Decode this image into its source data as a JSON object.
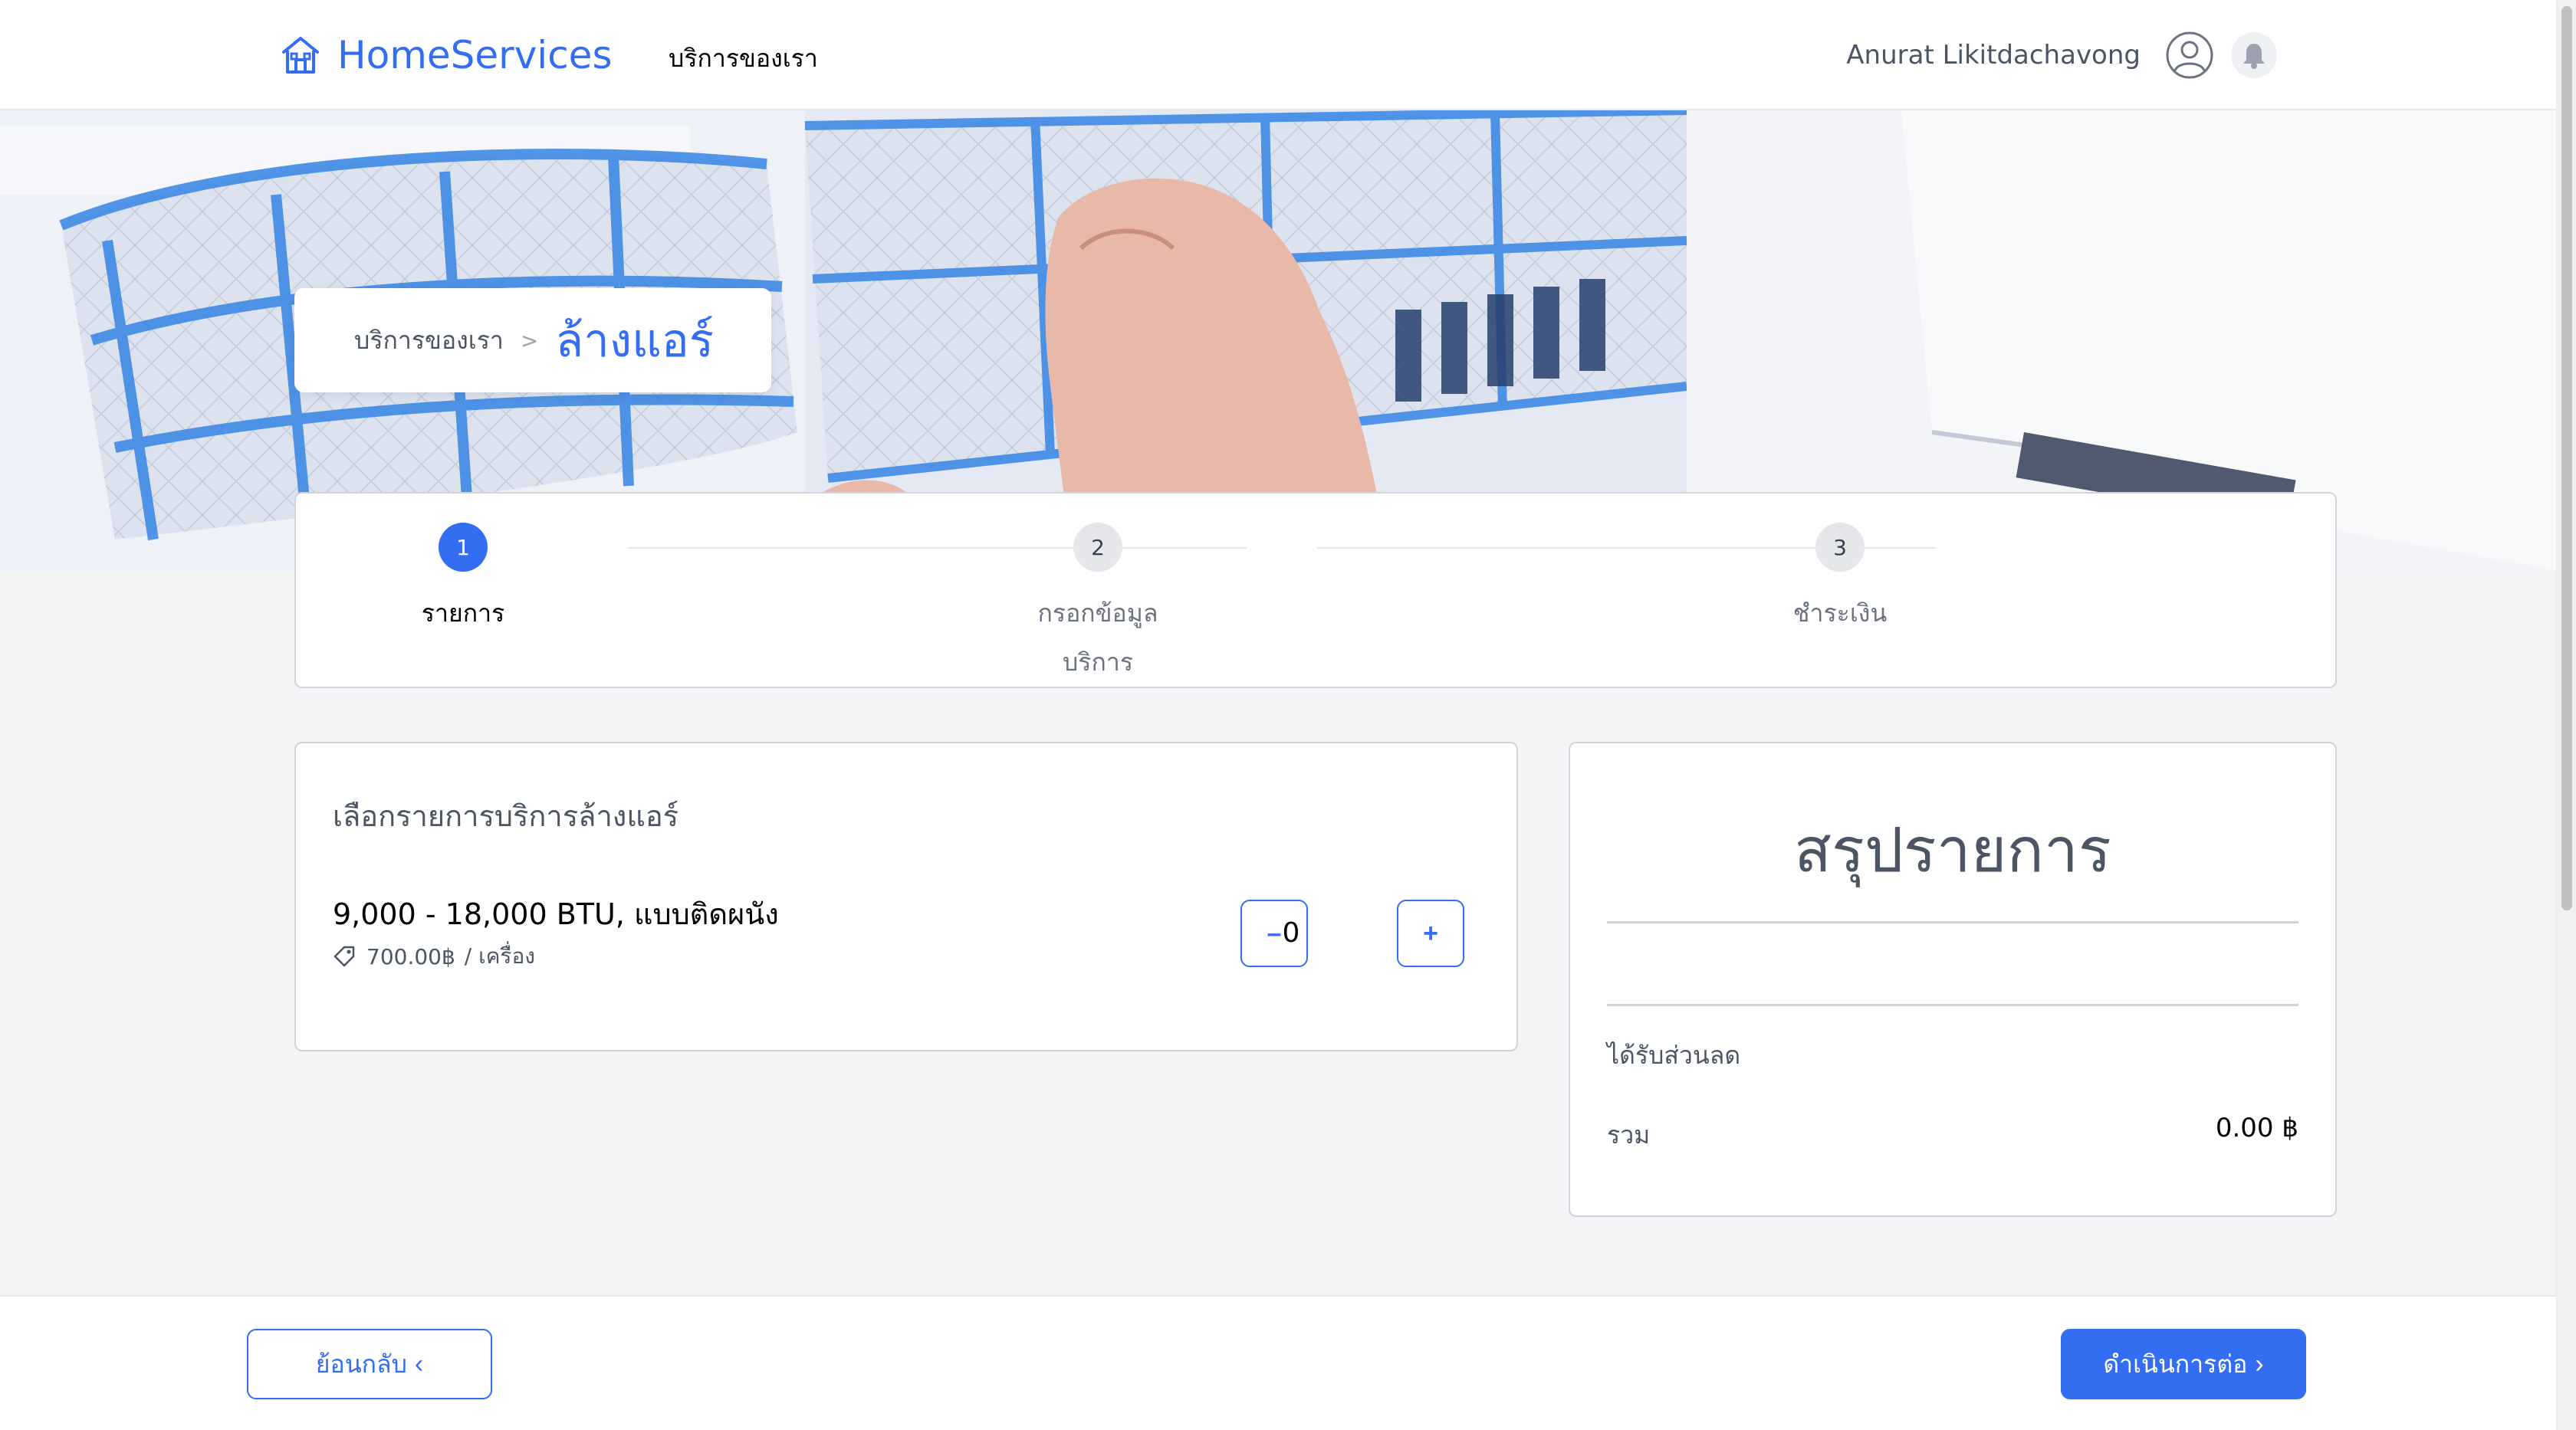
{
  "navbar": {
    "brand": "HomeServices",
    "nav_link": "บริการของเรา",
    "user_name": "Anurat Likitdachavong"
  },
  "breadcrumb": {
    "parent": "บริการของเรา",
    "separator": ">",
    "current": "ล้างแอร์"
  },
  "stepper": {
    "steps": [
      {
        "number": "1",
        "label": "รายการ",
        "active": true
      },
      {
        "number": "2",
        "label": "กรอกข้อมูลบริการ",
        "active": false
      },
      {
        "number": "3",
        "label": "ชำระเงิน",
        "active": false
      }
    ]
  },
  "service": {
    "title": "เลือกรายการบริการล้างแอร์",
    "item": {
      "name": "9,000 - 18,000 BTU, แบบติดผนัง",
      "price": "700.00฿",
      "unit": "/ เครื่อง",
      "quantity": "0",
      "minus_label": "–",
      "plus_label": "+"
    }
  },
  "summary": {
    "title": "สรุปรายการ",
    "discount_label": "ได้รับส่วนลด",
    "total_label": "รวม",
    "total_value": "0.00 ฿"
  },
  "footer": {
    "back_label": "ย้อนกลับ",
    "next_label": "ดำเนินการต่อ"
  },
  "colors": {
    "primary": "#336DF2",
    "background": "#F3F4F6"
  }
}
